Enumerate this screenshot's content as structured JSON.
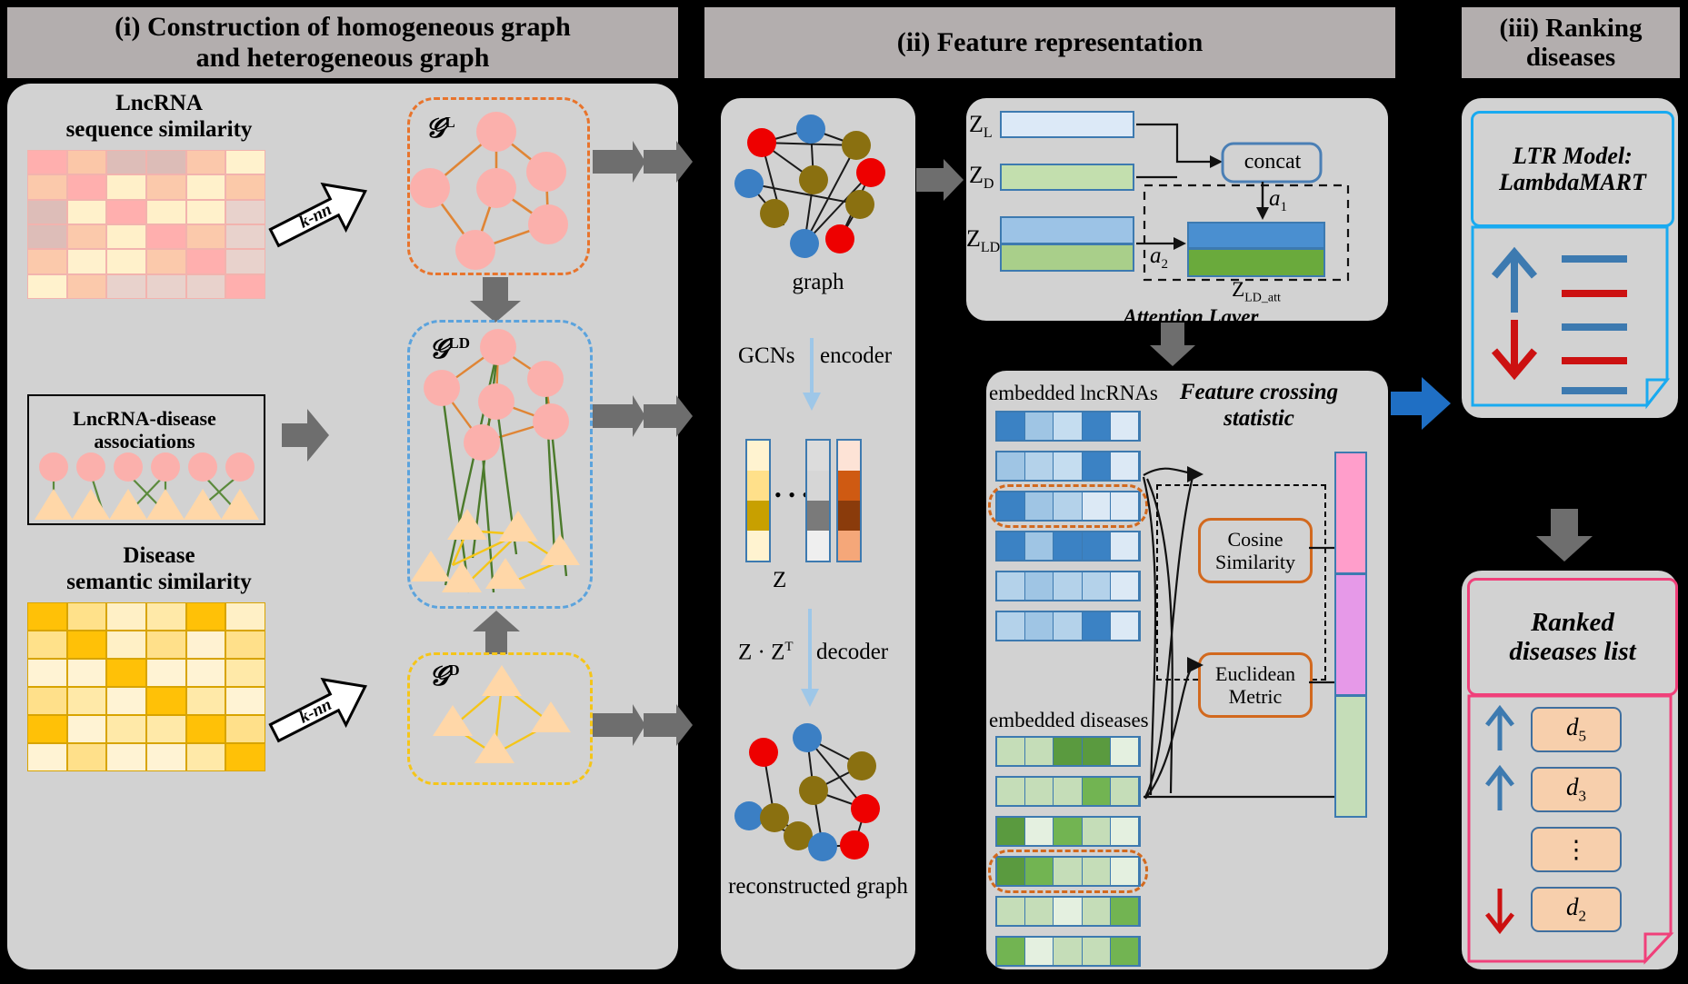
{
  "headers": {
    "h1": "(i) Construction of homogeneous graph\nand heterogeneous graph",
    "h1_line1": "(i) Construction of homogeneous graph",
    "h1_line2": "and heterogeneous graph",
    "h2": "(ii) Feature representation",
    "h3_line1": "(iii) Ranking",
    "h3_line2": "diseases"
  },
  "panel_i": {
    "lncrna_matrix_title_1": "LncRNA",
    "lncrna_matrix_title_2": "sequence similarity",
    "knn_label_top": "k-nn",
    "knn_label_bottom": "k-nn",
    "assoc_title_1": "LncRNA-disease",
    "assoc_title_2": "associations",
    "disease_matrix_title_1": "Disease",
    "disease_matrix_title_2": "semantic similarity",
    "graph_L_label": "𝒢",
    "graph_L_sup": "L",
    "graph_LD_label": "𝒢",
    "graph_LD_sup": "LD",
    "graph_D_label": "𝒢",
    "graph_D_sup": "D",
    "lncrna_matrix": [
      [
        "#ffafae",
        "#fbc7a8",
        "#ddbdb8",
        "#dcbcb7",
        "#fbc8ab",
        "#fff2cd"
      ],
      [
        "#fbc9ab",
        "#ffafae",
        "#fff0c9",
        "#fbc9ab",
        "#fff1cb",
        "#fbc9a9"
      ],
      [
        "#ddbdb8",
        "#fff1cb",
        "#ffafae",
        "#fff0c9",
        "#fff1cb",
        "#e8d2cc"
      ],
      [
        "#ddbdb8",
        "#fbc9ab",
        "#fff0c9",
        "#ffafae",
        "#fbc9ab",
        "#e8d2cc"
      ],
      [
        "#fbc9ab",
        "#fff1cd",
        "#fff1cb",
        "#fbc9ab",
        "#ffafae",
        "#e8d2cc"
      ],
      [
        "#fff2cd",
        "#fbc9ab",
        "#e8d2cc",
        "#e8d2cc",
        "#e8d2cc",
        "#ffafae"
      ]
    ],
    "disease_matrix": [
      [
        "#ffc107",
        "#ffe18a",
        "#fff0c6",
        "#ffe9a8",
        "#ffc107",
        "#fff0c6"
      ],
      [
        "#ffe18a",
        "#ffc107",
        "#fff0c6",
        "#ffe08a",
        "#fff2d2",
        "#ffe08a"
      ],
      [
        "#fff3d4",
        "#fff3d4",
        "#ffc107",
        "#fff3d4",
        "#fff3d4",
        "#ffe9a8"
      ],
      [
        "#ffe08a",
        "#ffe9a8",
        "#fff3d4",
        "#ffc107",
        "#ffe9a8",
        "#fff3d4"
      ],
      [
        "#ffc107",
        "#fff3d4",
        "#ffe9a8",
        "#ffe9a8",
        "#ffc107",
        "#ffe08a"
      ],
      [
        "#fff3d4",
        "#ffe08a",
        "#fff3d4",
        "#fff3d4",
        "#ffe9a8",
        "#ffc107"
      ]
    ]
  },
  "panel_ii": {
    "graph_label": "graph",
    "gcn_label": "GCNs",
    "encoder_label": "encoder",
    "z_label": "Z",
    "z_dots": "• • •",
    "decoder_formula": "Z · Z",
    "decoder_formula_sup": "T",
    "decoder_label": "decoder",
    "reconstructed_label": "reconstructed graph",
    "zl_label": "Z",
    "zl_sub": "L",
    "zd_label": "Z",
    "zd_sub": "D",
    "zld_label": "Z",
    "zld_sub": "LD",
    "concat_label": "concat",
    "a1_label": "a",
    "a1_sub": "1",
    "a2_label": "a",
    "a2_sub": "2",
    "zld_att_label": "Z",
    "zld_att_sub": "LD_att",
    "attention_layer_label": "Attention Layer",
    "embedded_lncrnas_label": "embedded lncRNAs",
    "embedded_diseases_label": "embedded diseases",
    "feature_crossing_1": "Feature crossing",
    "feature_crossing_2": "statistic",
    "cosine_line1": "Cosine",
    "cosine_line2": "Similarity",
    "euclid_line1": "Euclidean",
    "euclid_line2": "Metric",
    "lncrna_embed_rows": [
      [
        "#3b82c4",
        "#9fc5e4",
        "#c5ddf0",
        "#3b82c4",
        "#dce9f5"
      ],
      [
        "#9fc5e4",
        "#b4d2ea",
        "#c5ddf0",
        "#3b82c4",
        "#dce9f5"
      ],
      [
        "#3b82c4",
        "#9fc5e4",
        "#b4d2ea",
        "#dce9f5",
        "#dce9f5"
      ],
      [
        "#3b82c4",
        "#9fc5e4",
        "#3b82c4",
        "#3b82c4",
        "#dce9f5"
      ],
      [
        "#b4d2ea",
        "#9fc5e4",
        "#b4d2ea",
        "#b4d2ea",
        "#dce9f5"
      ],
      [
        "#b4d2ea",
        "#9fc5e4",
        "#b4d2ea",
        "#3b82c4",
        "#dce9f5"
      ]
    ],
    "disease_embed_rows": [
      [
        "#c5ddb8",
        "#c5ddb8",
        "#5a9a3f",
        "#5a9a3f",
        "#e4f0e0"
      ],
      [
        "#c5ddb8",
        "#c5ddb8",
        "#c5ddb8",
        "#72b452",
        "#c5ddb8"
      ],
      [
        "#5a9a3f",
        "#e4f0e0",
        "#72b452",
        "#c5ddb8",
        "#e4f0e0"
      ],
      [
        "#5a9a3f",
        "#72b452",
        "#c5ddb8",
        "#c5ddb8",
        "#e4f0e0"
      ],
      [
        "#c5ddb8",
        "#c5ddb8",
        "#e4f0e0",
        "#c5ddb8",
        "#72b452"
      ],
      [
        "#72b452",
        "#e4f0e0",
        "#c5ddb8",
        "#c5ddb8",
        "#72b452"
      ]
    ],
    "output_bar_colors": [
      "#ff9ecb",
      "#e699e8",
      "#c5ddb8"
    ],
    "z_col1": [
      "#fff3d0",
      "#ffe08a",
      "#c8a000",
      "#fff3d0"
    ],
    "z_col2": [
      "#dcdcdc",
      "#d6d6d6",
      "#7a7a7a",
      "#efefef"
    ],
    "z_col3": [
      "#fde3d6",
      "#cf5a12",
      "#8a3b0b",
      "#f5a779"
    ],
    "graph_node_colors": {
      "blue": "#3b7fc4",
      "red": "#ee0000",
      "olive": "#8a7010"
    }
  },
  "panel_iii": {
    "ltr_line1": "LTR Model:",
    "ltr_line2": "LambdaMART",
    "ranked_line1": "Ranked",
    "ranked_line2": "diseases list",
    "ranked_items": [
      {
        "arrow": "up",
        "label": "d",
        "sub": "5"
      },
      {
        "arrow": "up",
        "label": "d",
        "sub": "3"
      },
      {
        "arrow": "none",
        "label": "⋮",
        "sub": ""
      },
      {
        "arrow": "down",
        "label": "d",
        "sub": "2"
      }
    ],
    "rank_line_colors": [
      "#3d7ab0",
      "#cc1111",
      "#3d7ab0",
      "#cc1111",
      "#3d7ab0"
    ]
  },
  "colors": {
    "panel_bg": "#d2d2d2",
    "header_bg": "#b3aeae",
    "arrow_grey": "#6e6e6e",
    "accent_orange": "#e8742c",
    "accent_blue": "#5ba3dd",
    "accent_yellow": "#f5c518",
    "lncrna_node": "#fbb0ac",
    "disease_node": "#ffd7a8",
    "edge_orange": "#e08535",
    "edge_green": "#4b7a2b",
    "edge_yellow": "#f5c518",
    "ltr_border": "#19aaf0",
    "ranked_border": "#f0407a",
    "blue_arrow": "#1f6fc4"
  }
}
